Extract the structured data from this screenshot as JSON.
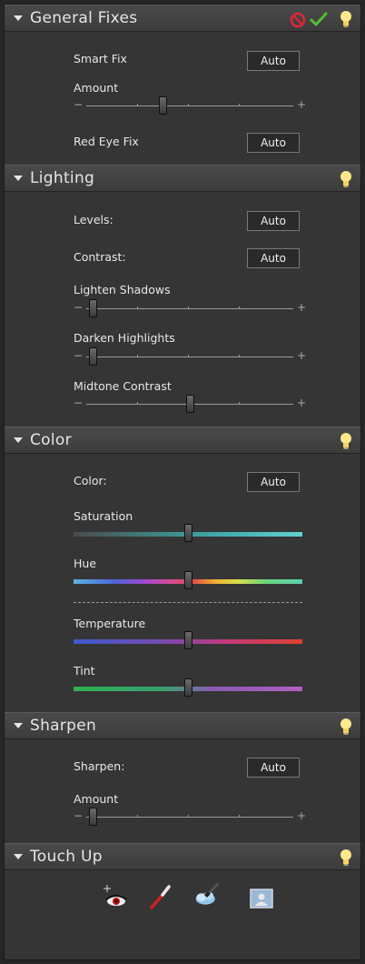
{
  "sections": {
    "general_fixes": {
      "title": "General Fixes",
      "smart_fix_label": "Smart Fix",
      "smart_fix_button": "Auto",
      "amount_label": "Amount",
      "amount_value": 0.37,
      "red_eye_label": "Red Eye Fix",
      "red_eye_button": "Auto"
    },
    "lighting": {
      "title": "Lighting",
      "levels_label": "Levels:",
      "levels_button": "Auto",
      "contrast_label": "Contrast:",
      "contrast_button": "Auto",
      "lighten_shadows_label": "Lighten Shadows",
      "lighten_shadows_value": 0.03,
      "darken_highlights_label": "Darken Highlights",
      "darken_highlights_value": 0.03,
      "midtone_contrast_label": "Midtone Contrast",
      "midtone_contrast_value": 0.5
    },
    "color": {
      "title": "Color",
      "color_label": "Color:",
      "color_button": "Auto",
      "saturation_label": "Saturation",
      "saturation_value": 0.5,
      "hue_label": "Hue",
      "hue_value": 0.5,
      "temperature_label": "Temperature",
      "temperature_value": 0.5,
      "tint_label": "Tint",
      "tint_value": 0.5
    },
    "sharpen": {
      "title": "Sharpen",
      "sharpen_label": "Sharpen:",
      "sharpen_button": "Auto",
      "amount_label": "Amount",
      "amount_value": 0.03
    },
    "touch_up": {
      "title": "Touch Up"
    }
  },
  "slider_signs": {
    "minus": "−",
    "plus": "+"
  },
  "icons": {
    "cancel": "cancel-icon",
    "commit": "checkmark-icon",
    "tip": "lightbulb-icon",
    "red_eye_tool": "red-eye-removal-tool-icon",
    "whiten_teeth_tool": "whiten-teeth-brush-icon",
    "blue_sky_tool": "make-blue-skies-icon",
    "bw_tool": "black-and-white-portrait-icon"
  },
  "colors": {
    "panel": "#353535",
    "header": "#434343",
    "cancel_red": "#e0243a",
    "commit_green": "#4fc22f",
    "bulb_yellow": "#ffe98a"
  }
}
